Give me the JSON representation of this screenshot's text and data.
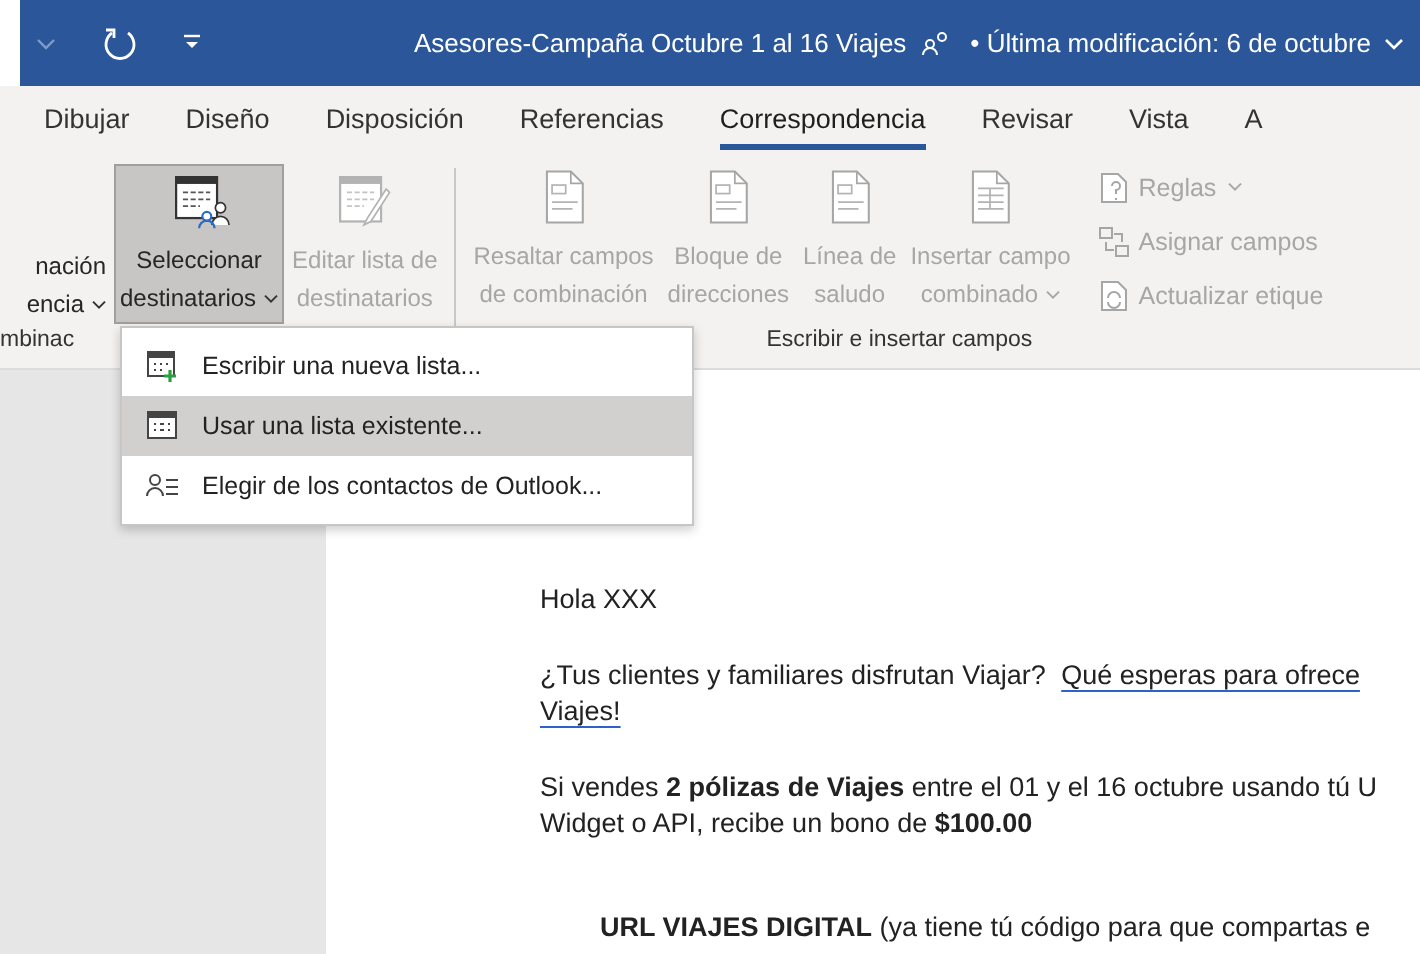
{
  "title_bar": {
    "title": "Asesores-Campaña Octubre 1 al 16 Viajes",
    "status": "• Última modificación: 6 de octubre"
  },
  "tabs": [
    {
      "label": "Dibujar",
      "selected": false
    },
    {
      "label": "Diseño",
      "selected": false
    },
    {
      "label": "Disposición",
      "selected": false
    },
    {
      "label": "Referencias",
      "selected": false
    },
    {
      "label": "Correspondencia",
      "selected": true
    },
    {
      "label": "Revisar",
      "selected": false
    },
    {
      "label": "Vista",
      "selected": false
    },
    {
      "label": "A",
      "selected": false
    }
  ],
  "ribbon": {
    "groups": [
      {
        "label": "mbinac",
        "buttons": [
          {
            "kind": "large",
            "lines": [
              "nación",
              "encia"
            ],
            "dropdown": true,
            "disabled": false,
            "pressed": false
          }
        ]
      },
      {
        "buttons": [
          {
            "kind": "large",
            "lines": [
              "Seleccionar",
              "destinatarios"
            ],
            "dropdown": true,
            "disabled": false,
            "pressed": true
          },
          {
            "kind": "large",
            "lines": [
              "Editar lista de",
              "destinatarios"
            ],
            "dropdown": false,
            "disabled": true,
            "pressed": false
          }
        ]
      },
      {
        "label": "Escribir e insertar campos",
        "buttons": [
          {
            "kind": "large",
            "lines": [
              "Resaltar campos",
              "de combinación"
            ],
            "dropdown": false,
            "disabled": true,
            "pressed": false
          },
          {
            "kind": "large",
            "lines": [
              "Bloque de",
              "direcciones"
            ],
            "dropdown": false,
            "disabled": true,
            "pressed": false
          },
          {
            "kind": "large",
            "lines": [
              "Línea de",
              "saludo"
            ],
            "dropdown": false,
            "disabled": true,
            "pressed": false
          },
          {
            "kind": "large",
            "lines": [
              "Insertar campo",
              "combinado"
            ],
            "dropdown": true,
            "disabled": true,
            "pressed": false
          },
          {
            "kind": "small",
            "lines": [
              "Reglas"
            ],
            "dropdown": true,
            "disabled": true,
            "pressed": false
          },
          {
            "kind": "small",
            "lines": [
              "Asignar campos"
            ],
            "dropdown": false,
            "disabled": true,
            "pressed": false
          },
          {
            "kind": "small",
            "lines": [
              "Actualizar etique"
            ],
            "dropdown": false,
            "disabled": true,
            "pressed": false
          }
        ]
      }
    ]
  },
  "menu": {
    "items": [
      {
        "label": "Escribir una nueva lista...",
        "selected": false
      },
      {
        "label": "Usar una lista existente...",
        "selected": true
      },
      {
        "label": "Elegir de los contactos de Outlook...",
        "selected": false
      }
    ]
  },
  "document": {
    "paragraphs": [
      {
        "kind": "plain",
        "lines": [
          {
            "text": "Hola XXX"
          }
        ]
      },
      {
        "kind": "plain",
        "lines": [
          {
            "text": "¿Tus clientes y familiares disfrutan Viajar?",
            "link": "Qué esperas para ofrece"
          },
          {
            "link": "Viajes!"
          }
        ]
      },
      {
        "kind": "plain",
        "lines": [
          {
            "text": "Si vendes **2 pólizas de Viajes** entre el 01 y el 16 octubre usando tú U"
          },
          {
            "text": "Widget o API, recibe un bono de **$100.00**"
          }
        ]
      },
      {
        "kind": "indented",
        "lines": [
          {
            "text": "**URL VIAJES DIGITAL** (ya tiene tú código para que compartas e"
          }
        ]
      }
    ]
  }
}
